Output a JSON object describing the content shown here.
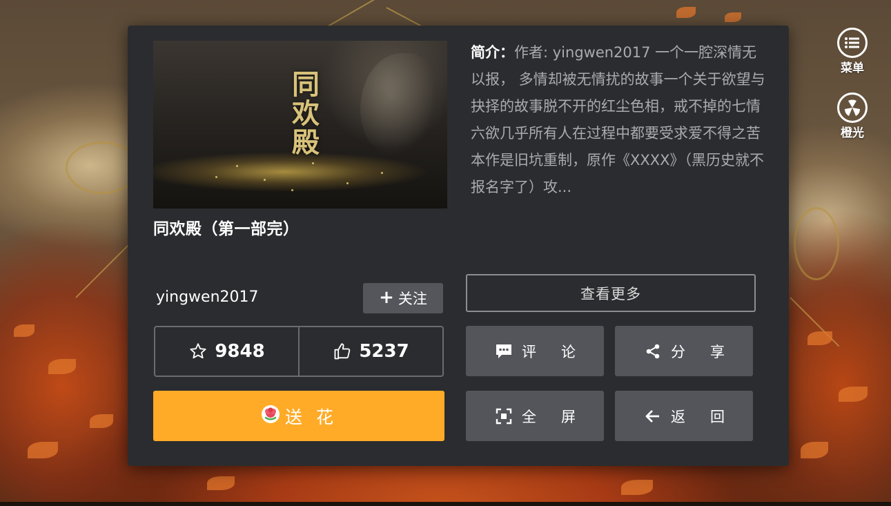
{
  "book": {
    "title": "同欢殿（第一部完）",
    "cover_title": "同欢殿",
    "intro_label": "简介：",
    "intro_text": "作者: yingwen2017 一个一腔深情无以报， 多情却被无情扰的故事一个关于欲望与抉择的故事脱不开的红尘色相，戒不掉的七情六欲几乎所有人在过程中都要受求爱不得之苦本作是旧坑重制，原作《XXXX》（黑历史就不报名字了）攻..."
  },
  "author": {
    "name": "yingwen2017",
    "follow_label": "关注",
    "follow_icon": "plus-icon"
  },
  "stats": {
    "favorites": "9848",
    "favorites_icon": "star-outline-icon",
    "likes": "5237",
    "likes_icon": "thumbs-up-icon"
  },
  "buttons": {
    "send_flower": "送 花",
    "send_flower_icon": "flower-icon",
    "more": "查看更多",
    "comment": "评论",
    "share": "分享",
    "fullscreen": "全屏",
    "back": "返回"
  },
  "side": {
    "menu": "菜单",
    "menu_icon": "list-icon",
    "light": "橙光",
    "light_icon": "orange-light-logo-icon"
  },
  "colors": {
    "panel": "#2b2c2f",
    "accent": "#ffab28",
    "button": "#53555a",
    "muted_text": "#a9abae"
  }
}
